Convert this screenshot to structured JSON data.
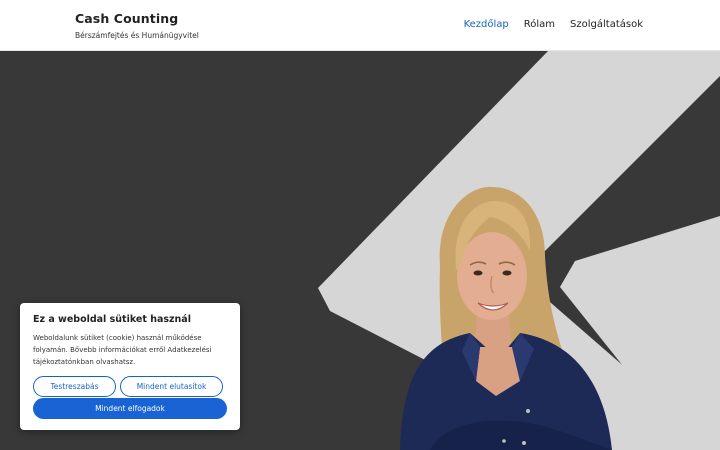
{
  "header": {
    "site_title": "Cash Counting",
    "tagline": "Bérszámfejtés és Humánügyvitel",
    "nav": [
      {
        "label": "Kezdőlap",
        "active": true
      },
      {
        "label": "Rólam",
        "active": false
      },
      {
        "label": "Szolgáltatások",
        "active": false
      }
    ]
  },
  "hero": {
    "background_color": "#383838",
    "shape_color": "#d6d6d6",
    "image": "woman-portrait"
  },
  "cookie_banner": {
    "title": "Ez a weboldal sütiket használ",
    "text": "Weboldalunk sütiket (cookie) használ működése folyamán. Bővebb információkat erről Adatkezelési tájékoztatónkban olvashatsz.",
    "customize_label": "Testreszabás",
    "reject_label": "Mindent elutasítok",
    "accept_label": "Mindent elfogadok"
  },
  "colors": {
    "accent": "#1565c0",
    "accept_button": "#1a63d4"
  }
}
